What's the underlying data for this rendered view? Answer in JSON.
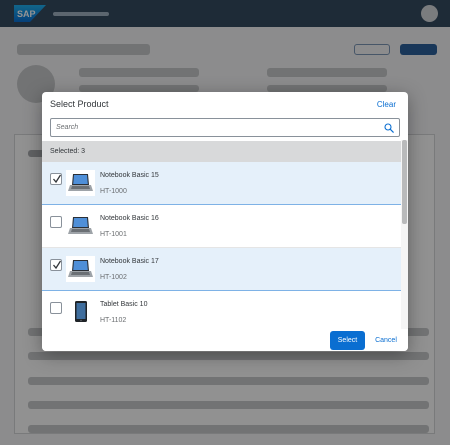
{
  "shell": {
    "logo_text": "SAP",
    "logo_icon": "sap-logo"
  },
  "dialog": {
    "title": "Select Product",
    "clear_label": "Clear",
    "search": {
      "placeholder": "Search",
      "icon": "search-icon"
    },
    "info_bar": "Selected: 3",
    "items": [
      {
        "name": "Notebook Basic 15",
        "id": "HT-1000",
        "selected": true,
        "thumbnail": "laptop-icon"
      },
      {
        "name": "Notebook Basic 16",
        "id": "HT-1001",
        "selected": false,
        "thumbnail": "laptop-icon"
      },
      {
        "name": "Notebook Basic 17",
        "id": "HT-1002",
        "selected": true,
        "thumbnail": "laptop-icon"
      },
      {
        "name": "Tablet Basic 10",
        "id": "HT-1102",
        "selected": false,
        "thumbnail": "tablet-icon"
      }
    ],
    "buttons": {
      "select": "Select",
      "cancel": "Cancel"
    }
  },
  "colors": {
    "shell_bg": "#354a5f",
    "accent": "#0a6ed1",
    "selected_row": "#e5f0fa"
  }
}
